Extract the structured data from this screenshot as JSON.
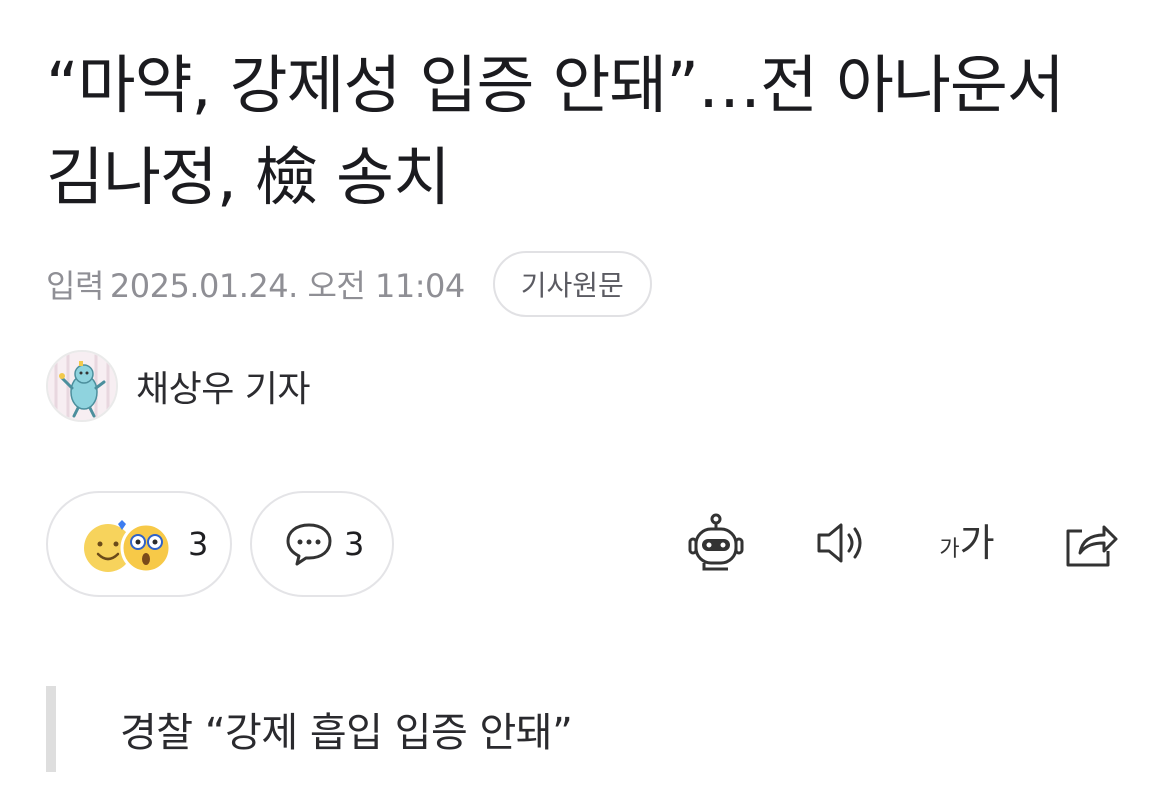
{
  "article": {
    "headline": "“마약, 강제성 입증 안돼”…전 아나운서 김나정, 檢 송치",
    "meta": {
      "published_label": "입력",
      "published_date": "2025.01.24. 오전 11:04",
      "original_button": "기사원문"
    },
    "reporter": {
      "name": "채상우 기자",
      "avatar_icon": "reporter-avatar-illustration"
    },
    "reactions": {
      "count": "3",
      "icons": [
        "smile-face-icon",
        "surprised-face-icon"
      ]
    },
    "comments": {
      "count": "3",
      "icon": "speech-bubble-icon"
    },
    "tools": {
      "icons": [
        "robot-summary-icon",
        "speaker-icon",
        "font-size-icon",
        "share-icon"
      ],
      "font_size_small": "가",
      "font_size_large": "가"
    },
    "subheading": "경찰 “강제 흡입 입증 안돼”"
  }
}
